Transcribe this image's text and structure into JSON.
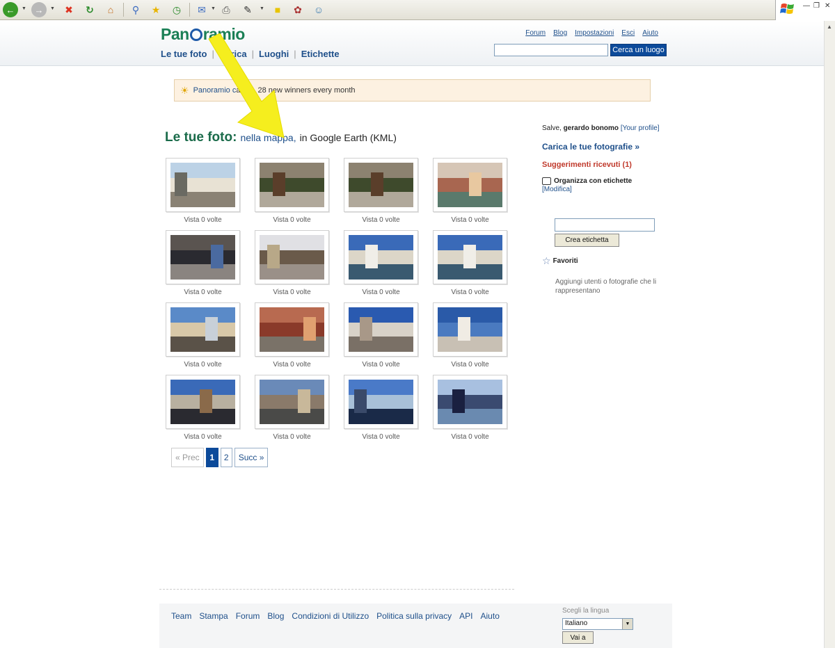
{
  "header": {
    "logo_text_before": "Pan",
    "logo_text_after": "ramio",
    "nav": [
      {
        "label": "Le tue foto"
      },
      {
        "label": "Carica"
      },
      {
        "label": "Luoghi"
      },
      {
        "label": "Etichette"
      }
    ],
    "top_links": [
      "Forum",
      "Blog",
      "Impostazioni",
      "Esci",
      "Aiuto"
    ],
    "search_button": "Cerca un luogo",
    "search_value": ""
  },
  "notice": {
    "link": "Panoramio c",
    "text": "arted. 28 new winners every month"
  },
  "heading": {
    "title": "Le tue foto:",
    "map_link": "nella mappa,",
    "rest": "in Google Earth (KML)"
  },
  "photos": [
    {
      "views": "Vista 0 volte",
      "scene": "station"
    },
    {
      "views": "Vista 0 volte",
      "scene": "alley"
    },
    {
      "views": "Vista 0 volte",
      "scene": "alley"
    },
    {
      "views": "Vista 0 volte",
      "scene": "canal"
    },
    {
      "views": "Vista 0 volte",
      "scene": "statue"
    },
    {
      "views": "Vista 0 volte",
      "scene": "lane"
    },
    {
      "views": "Vista 0 volte",
      "scene": "bridge"
    },
    {
      "views": "Vista 0 volte",
      "scene": "bridge"
    },
    {
      "views": "Vista 0 volte",
      "scene": "market"
    },
    {
      "views": "Vista 0 volte",
      "scene": "redbuilding"
    },
    {
      "views": "Vista 0 volte",
      "scene": "church"
    },
    {
      "views": "Vista 0 volte",
      "scene": "sky"
    },
    {
      "views": "Vista 0 volte",
      "scene": "piazza"
    },
    {
      "views": "Vista 0 volte",
      "scene": "basilica"
    },
    {
      "views": "Vista 0 volte",
      "scene": "gondolas"
    },
    {
      "views": "Vista 0 volte",
      "scene": "gondolas2"
    }
  ],
  "pagination": {
    "prev": "« Prec",
    "pages": [
      "1",
      "2"
    ],
    "current": "1",
    "next": "Succ »"
  },
  "sidebar": {
    "greeting_prefix": "Salve,",
    "user": "gerardo bonomo",
    "profile_link": "[Your profile]",
    "upload_link": "Carica le tue fotografie »",
    "suggestions_link": "Suggerimenti ricevuti (1)",
    "tags_title": "Organizza con etichette",
    "modify_link": "[Modifica]",
    "tag_button": "Crea etichetta",
    "favorites_title": "Favoriti",
    "favorites_text": "Aggiungi utenti o fotografie che li rappresentano"
  },
  "footer": {
    "links": [
      "Team",
      "Stampa",
      "Forum",
      "Blog",
      "Condizioni di Utilizzo",
      "Politica sulla privacy",
      "API",
      "Aiuto"
    ],
    "lang_label": "Scegli la lingua",
    "lang_value": "Italiano",
    "lang_button": "Vai a"
  },
  "colors": {
    "brand_green": "#1a7f55",
    "link_blue": "#1e4f8a",
    "accent_red": "#c0392b",
    "arrow_yellow": "#f5ee1e"
  }
}
